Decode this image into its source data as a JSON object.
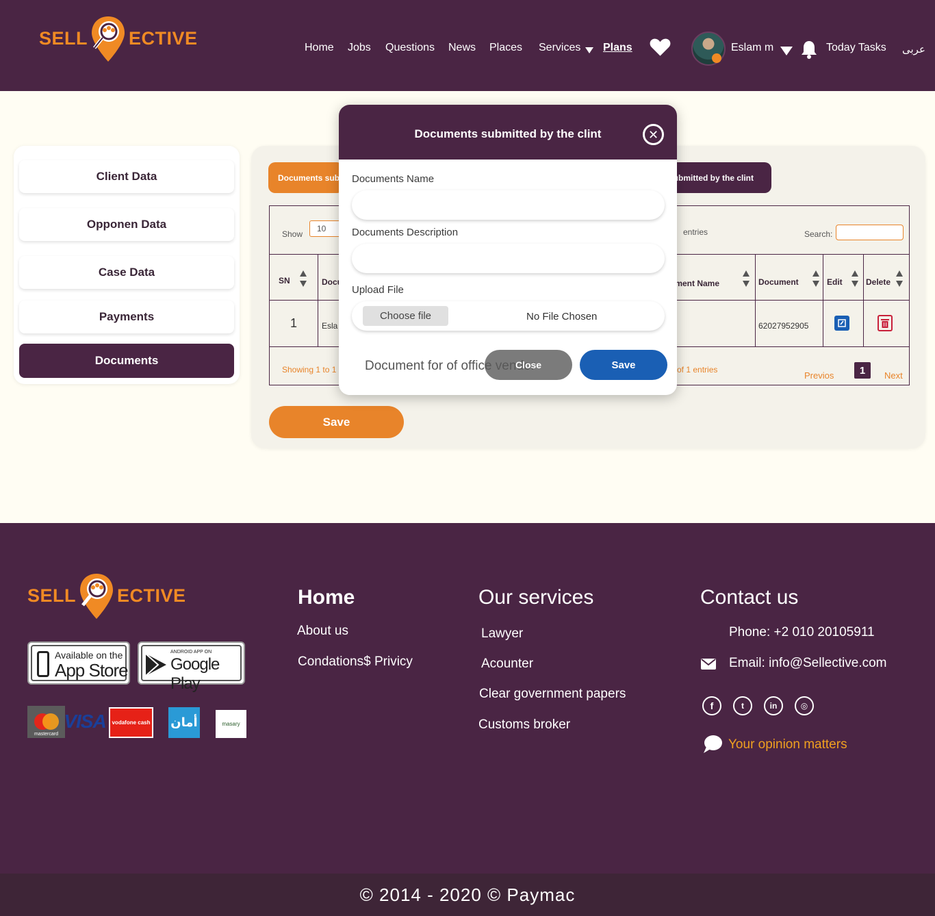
{
  "brand": {
    "left": "SELL",
    "right": "ECTIVE",
    "orange": "#f08a24",
    "purple": "#4a2544"
  },
  "nav": {
    "home": "Home",
    "jobs": "Jobs",
    "questions": "Questions",
    "news": "News",
    "places": "Places",
    "services": "Services",
    "plans": "Plans",
    "user_name": "Eslam m",
    "tasks": "Today Tasks",
    "lang": "عربى"
  },
  "sidebar": {
    "items": [
      {
        "label": "Client Data"
      },
      {
        "label": "Opponen Data"
      },
      {
        "label": "Case Data"
      },
      {
        "label": "Payments"
      },
      {
        "label": "Documents"
      }
    ]
  },
  "panel": {
    "tab_left": "Documents submitted by the lawyer",
    "tab_right": "Documents submitted by the clint",
    "show_label": "Show",
    "show_value": "10",
    "entries_label": "entries",
    "search_label": "Search:",
    "headers": {
      "sn": "SN",
      "doc": "Document Name",
      "name": "Document Name",
      "document": "Document",
      "edit": "Edit",
      "delete": "Delete"
    },
    "row": {
      "sn": "1",
      "doc": "Eslam",
      "document": "62027952905"
    },
    "showing_left": "Showing 1 to 1",
    "showing_right": "of 1 entries",
    "prev": "Previos",
    "page": "1",
    "next": "Next",
    "save": "Save"
  },
  "modal": {
    "title": "Documents submitted by the clint",
    "name_label": "Documents Name",
    "name_value": "",
    "desc_label": "Documents Description",
    "desc_value": "",
    "upload_label": "Upload File",
    "choose": "Choose file",
    "no_file": "No File Chosen",
    "doc_text": "Document for of office vendor",
    "close": "Close",
    "save": "Save"
  },
  "footer": {
    "home": "Home",
    "about": "About us",
    "conditions": "Condations$ Privicy",
    "services_head": "Our services",
    "services": [
      "Lawyer",
      "Acounter",
      "Clear government papers",
      "Customs broker"
    ],
    "contact_head": "Contact us",
    "phone": "Phone: +2 010 20105911",
    "email": "Email: info@Sellective.com",
    "opinion": "Your opinion matters",
    "appstore_small": "Available on the",
    "appstore_big": "App Store",
    "google_small": "ANDROID APP ON",
    "google_big": "Google Play",
    "pay_mastercard": "mastercard",
    "pay_visa": "VISA",
    "pay_vodafone": "vodafone cash",
    "pay_aman": "أمان",
    "pay_masary": "masary"
  },
  "copyright": "© 2014 - 2020 © Paymac"
}
